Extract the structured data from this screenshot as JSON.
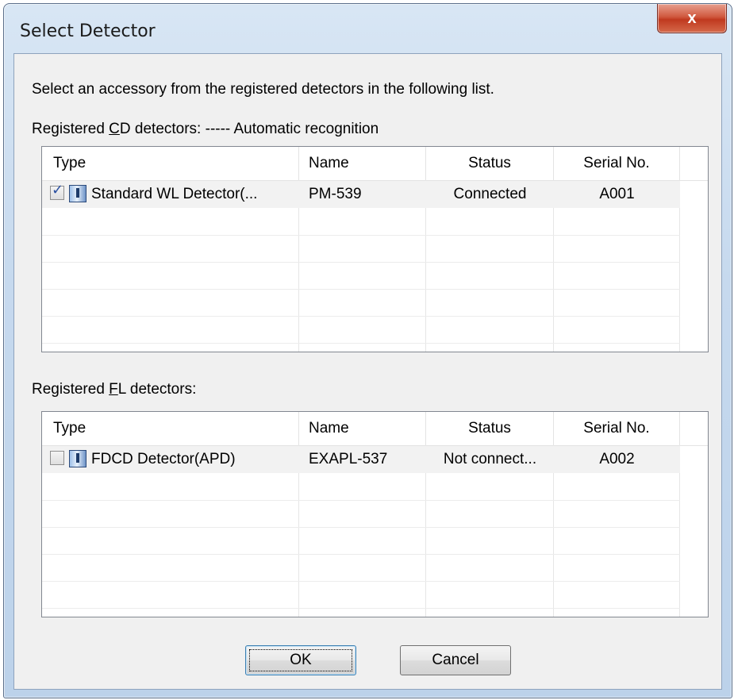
{
  "window": {
    "title": "Select Detector",
    "close_glyph": "x"
  },
  "intro_text": "Select an accessory from the registered detectors in the following list.",
  "cd_group": {
    "label_pre": "Registered ",
    "label_accel": "C",
    "label_post": "D detectors: ----- Automatic recognition",
    "columns": [
      "Type",
      "Name",
      "Status",
      "Serial No."
    ],
    "rows": [
      {
        "checked": true,
        "icon": "detector-icon",
        "type": "Standard WL Detector(...",
        "name": "PM-539",
        "status": "Connected",
        "serial": "A001"
      }
    ]
  },
  "fl_group": {
    "label_pre": "Registered ",
    "label_accel": "F",
    "label_post": "L detectors:",
    "columns": [
      "Type",
      "Name",
      "Status",
      "Serial No."
    ],
    "rows": [
      {
        "checked": false,
        "icon": "detector-icon",
        "type": "FDCD Detector(APD)",
        "name": "EXAPL-537",
        "status": "Not connect...",
        "serial": "A002"
      }
    ]
  },
  "buttons": {
    "ok": "OK",
    "cancel": "Cancel"
  }
}
